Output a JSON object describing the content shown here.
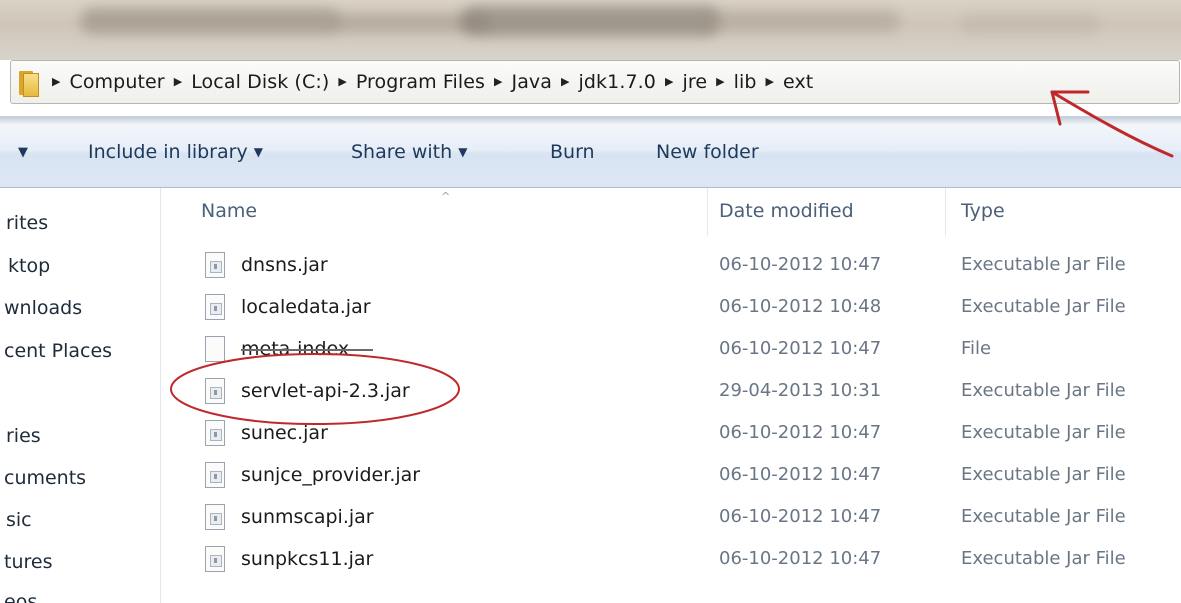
{
  "address_bar": {
    "crumbs": [
      "Computer",
      "Local Disk (C:)",
      "Program Files",
      "Java",
      "jdk1.7.0",
      "jre",
      "lib",
      "ext"
    ]
  },
  "toolbar": {
    "organize_arrow": "▼",
    "include_label": "Include in library",
    "share_label": "Share with",
    "burn_label": "Burn",
    "new_folder_label": "New folder",
    "dropdown_glyph": "▼"
  },
  "nav_pane": {
    "items": [
      "rites",
      "ktop",
      "wnloads",
      "cent Places",
      "ries",
      "cuments",
      "sic",
      "tures",
      "eos"
    ]
  },
  "file_list": {
    "columns": [
      "Name",
      "Date modified",
      "Type"
    ],
    "sort_glyph": "^",
    "rows": [
      {
        "name": "dnsns.jar",
        "date": "06-10-2012 10:47",
        "type": "Executable Jar File",
        "icon": "jar-file-icon"
      },
      {
        "name": "localedata.jar",
        "date": "06-10-2012 10:48",
        "type": "Executable Jar File",
        "icon": "jar-file-icon"
      },
      {
        "name": "meta-index",
        "date": "06-10-2012 10:47",
        "type": "File",
        "icon": "blank-file-icon"
      },
      {
        "name": "servlet-api-2.3.jar",
        "date": "29-04-2013 10:31",
        "type": "Executable Jar File",
        "icon": "jar-file-icon"
      },
      {
        "name": "sunec.jar",
        "date": "06-10-2012 10:47",
        "type": "Executable Jar File",
        "icon": "jar-file-icon"
      },
      {
        "name": "sunjce_provider.jar",
        "date": "06-10-2012 10:47",
        "type": "Executable Jar File",
        "icon": "jar-file-icon"
      },
      {
        "name": "sunmscapi.jar",
        "date": "06-10-2012 10:47",
        "type": "Executable Jar File",
        "icon": "jar-file-icon"
      },
      {
        "name": "sunpkcs11.jar",
        "date": "06-10-2012 10:47",
        "type": "Executable Jar File",
        "icon": "jar-file-icon"
      }
    ]
  },
  "annotations": {
    "color": "#c0292b",
    "circled_file": "servlet-api-2.3.jar"
  }
}
